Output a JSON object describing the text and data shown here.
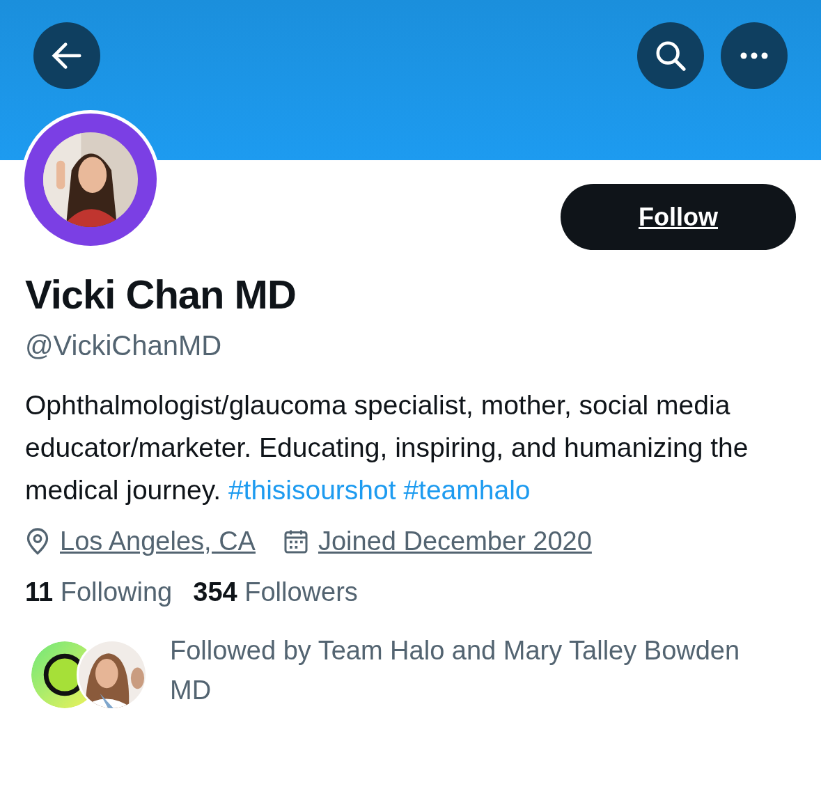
{
  "header": {
    "buttons": [
      {
        "kind": "back"
      },
      {
        "kind": "search"
      },
      {
        "kind": "more"
      }
    ]
  },
  "profile": {
    "avatar": {
      "kind": "picture"
    },
    "follow_button": "Follow",
    "name": "Vicki Chan MD",
    "handle": "@VickiChanMD",
    "bio": {
      "text": "Ophthalmologist/glaucoma specialist, mother, social media educator/marketer. Educating, inspiring, and humanizing the medical journey.",
      "hashtags": [
        "#thisisourshot",
        "#teamhalo"
      ]
    },
    "meta": [
      {
        "kind": "location",
        "text": "Los Angeles, CA"
      },
      {
        "kind": "joined",
        "text": "Joined December 2020"
      }
    ],
    "stats": [
      {
        "count": "11",
        "label": "Following"
      },
      {
        "count": "354",
        "label": "Followers"
      }
    ],
    "followed_by": {
      "avatars": [
        {
          "kind": "logo"
        },
        {
          "kind": "picture"
        }
      ],
      "text": "Followed by Team Halo and Mary Talley Bowden MD"
    }
  }
}
